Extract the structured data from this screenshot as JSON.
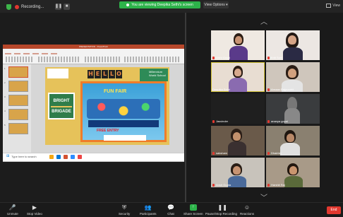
{
  "topbar": {
    "recording_label": "Recording...",
    "banner_text": "You are viewing Deepika Sethi's screen",
    "view_options_label": "View Options ▾",
    "view_label": "View"
  },
  "shared_screen": {
    "ppt_title": "PRESENTATION - PowerPoint",
    "search_placeholder": "Type here to search",
    "slide": {
      "hello_letters": [
        "H",
        "E",
        "L",
        "L",
        "O"
      ],
      "school_name": "Millennium World School",
      "badge_line1": "BRIGHT",
      "badge_line2": "BRIGADE",
      "poster_title": "FUN FAIR",
      "poster_entry": "FREE ENTRY"
    },
    "thumb_numbers": [
      "1",
      "2",
      "3",
      "4",
      "5"
    ]
  },
  "gallery": {
    "participants": [
      {
        "name": "Aishi Goyal",
        "active": false
      },
      {
        "name": "Kriti Soni",
        "active": false
      },
      {
        "name": "Deepika Sethi",
        "active": true
      },
      {
        "name": "Arnaan Rajpurohit",
        "active": false
      },
      {
        "name": "Jasvinder",
        "active": false
      },
      {
        "name": "ananya goyal",
        "active": false
      },
      {
        "name": "saksham",
        "active": false
      },
      {
        "name": "Dhairish",
        "active": false
      },
      {
        "name": "Ansh Gupta",
        "active": false
      },
      {
        "name": "Harshit Raj",
        "active": false
      }
    ]
  },
  "toolbar": {
    "unmute": "Unmute",
    "stop_video": "Stop Video",
    "security": "Security",
    "participants": "Participants",
    "participants_count": "33",
    "chat": "Chat",
    "share_screen": "Share Screen",
    "pause_recording": "Pause/Stop Recording",
    "reactions": "Reactions",
    "end": "End"
  },
  "colors": {
    "green": "#2db34a",
    "red": "#e2382f",
    "ppt_orange": "#d35230"
  }
}
